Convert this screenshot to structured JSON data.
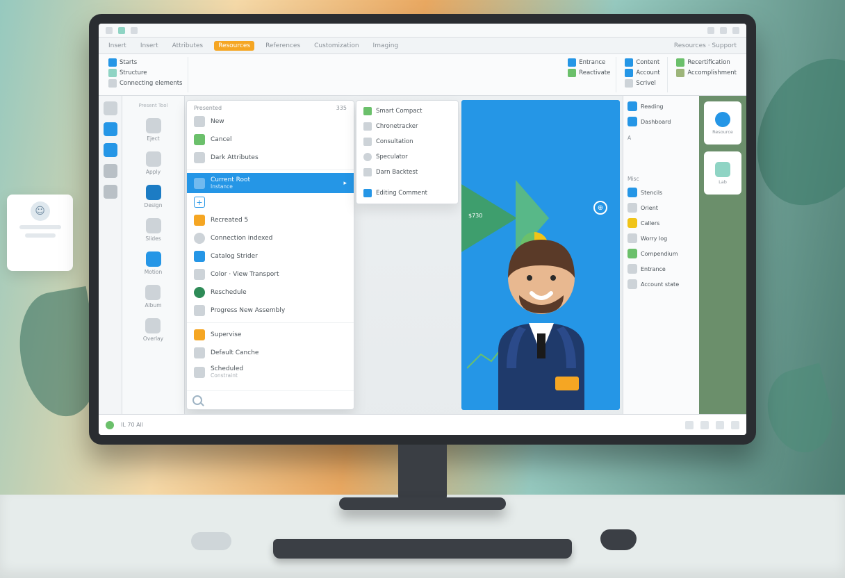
{
  "chrome": {
    "spacer": ""
  },
  "menubar": {
    "items": [
      "Insert",
      "Insert",
      "Attributes",
      "Resources",
      "References",
      "Customization",
      "Imaging"
    ],
    "right": "Resources · Support",
    "activeIndex": 3
  },
  "ribbon": {
    "left_groups": [
      {
        "icon": "folder-icon",
        "color": "c-blue",
        "label": "Starts"
      },
      {
        "icon": "grid-icon",
        "color": "c-mint",
        "label": "Structure"
      },
      {
        "icon": "card-icon",
        "color": "c-gray",
        "label": "Connecting elements"
      }
    ],
    "right_groups": [
      {
        "icon": "calendar-icon",
        "color": "c-blue",
        "label": "Entrance"
      },
      {
        "icon": "puzzle-icon",
        "color": "c-green",
        "label": "Reactivate"
      },
      {
        "icon": "paint-icon",
        "color": "c-blue",
        "label": "Content"
      },
      {
        "icon": "person-icon",
        "color": "c-blue",
        "label": "Account"
      },
      {
        "icon": "layers-icon",
        "color": "c-gray",
        "label": "Scrivel"
      },
      {
        "icon": "badge-icon",
        "color": "c-green",
        "label": "Recertification"
      },
      {
        "icon": "key-icon",
        "color": "c-olive",
        "label": "Accomplishment"
      }
    ]
  },
  "iconstrip": [
    {
      "name": "home-icon",
      "color": "c-gray"
    },
    {
      "name": "doc-icon",
      "color": "c-blue"
    },
    {
      "name": "layers-icon",
      "color": "c-blue"
    },
    {
      "name": "align-icon",
      "color": "c-gray2"
    },
    {
      "name": "text-icon",
      "color": "c-gray2"
    }
  ],
  "leftrail": {
    "title": "Present Tool",
    "items": [
      {
        "icon": "arrow-icon",
        "color": "c-gray",
        "label": "Eject"
      },
      {
        "icon": "bolt-icon",
        "color": "c-gray",
        "label": "Apply"
      },
      {
        "icon": "square-icon",
        "color": "c-blue-deep",
        "label": "Design"
      },
      {
        "icon": "slides-icon",
        "color": "c-gray",
        "label": "Slides"
      },
      {
        "icon": "motion-icon",
        "color": "c-blue",
        "label": "Motion"
      },
      {
        "icon": "album-icon",
        "color": "c-gray",
        "label": "Album"
      },
      {
        "icon": "overlay-icon",
        "color": "c-gray",
        "label": "Overlay"
      }
    ]
  },
  "panel": {
    "header_left": "Presented",
    "header_right": "335",
    "items": [
      {
        "icon": "star-icon",
        "color": "c-gray",
        "label": "New",
        "sub": ""
      },
      {
        "icon": "save-icon",
        "color": "c-green",
        "label": "Cancel",
        "sub": ""
      },
      {
        "icon": "doc-icon",
        "color": "c-gray",
        "label": "Dark Attributes",
        "sub": ""
      },
      {
        "icon": "page-icon",
        "color": "c-gray",
        "label": "Current Root",
        "sub": "Instance",
        "selected": true
      },
      {
        "icon": "plus-icon",
        "color": "c-blue",
        "label": "",
        "sub": ""
      },
      {
        "icon": "reload-icon",
        "color": "c-orange",
        "label": "Recreated 5",
        "sub": ""
      },
      {
        "icon": "radio-icon",
        "color": "c-gray",
        "label": "Connection indexed",
        "sub": ""
      },
      {
        "icon": "play-icon",
        "color": "c-blue",
        "label": "Catalog Strider",
        "sub": ""
      },
      {
        "icon": "color-icon",
        "color": "c-gray",
        "label": "Color · View Transport",
        "sub": ""
      },
      {
        "icon": "check-icon",
        "color": "c-green-deep",
        "label": "Reschedule",
        "sub": ""
      },
      {
        "icon": "track-icon",
        "color": "c-gray",
        "label": "Progress New Assembly",
        "sub": ""
      },
      {
        "icon": "folder-icon",
        "color": "c-orange",
        "label": "Supervise",
        "sub": ""
      },
      {
        "icon": "settings-icon",
        "color": "c-gray",
        "label": "Default Canche",
        "sub": ""
      },
      {
        "icon": "archive-icon",
        "color": "c-gray",
        "label": "Scheduled",
        "sub": "Constraint"
      }
    ],
    "search_label": "Search"
  },
  "flyout": {
    "items": [
      {
        "icon": "spark-icon",
        "color": "c-green",
        "label": "Smart Compact"
      },
      {
        "icon": "chain-icon",
        "color": "c-gray",
        "label": "Chronetracker"
      },
      {
        "icon": "cube-icon",
        "color": "c-gray",
        "label": "Consultation"
      },
      {
        "icon": "dot-icon",
        "color": "c-gray",
        "label": "Speculator"
      },
      {
        "icon": "tag-icon",
        "color": "c-gray",
        "label": "Darn Backtest"
      },
      {
        "icon": "mail-icon",
        "color": "c-blue",
        "label": "Editing Comment"
      }
    ]
  },
  "canvas": {
    "wedge_label": "$730",
    "target_label": "⊕"
  },
  "sideA": {
    "top": [
      {
        "icon": "recent-icon",
        "color": "c-blue",
        "label": "Reading"
      },
      {
        "icon": "cal-icon",
        "color": "c-blue",
        "label": "Dashboard"
      }
    ],
    "mid_header": "A",
    "mid": [],
    "bottom_header": "Misc",
    "bottom": [
      {
        "icon": "square-icon",
        "color": "c-blue",
        "label": "Stencils"
      },
      {
        "icon": "square-icon",
        "color": "c-gray",
        "label": "Orient"
      },
      {
        "icon": "square-icon",
        "color": "c-yellow",
        "label": "Callers"
      },
      {
        "icon": "square-icon",
        "color": "c-gray",
        "label": "Worry log"
      },
      {
        "icon": "pin-icon",
        "color": "c-green",
        "label": "Compendium"
      },
      {
        "icon": "gear-icon",
        "color": "c-gray",
        "label": "Entrance"
      },
      {
        "icon": "person-icon",
        "color": "c-gray",
        "label": "Account state"
      }
    ]
  },
  "sideB": {
    "cards": [
      {
        "glyph": "portrait-icon",
        "color": "c-blue",
        "label": "Resource"
      },
      {
        "glyph": "flask-icon",
        "color": "c-mint",
        "label": "Lab"
      }
    ]
  },
  "statusbar": {
    "left": "IL 70 All",
    "right_items": [
      "—",
      "—",
      "—"
    ]
  },
  "floating_card": {
    "icon": "person-icon"
  }
}
